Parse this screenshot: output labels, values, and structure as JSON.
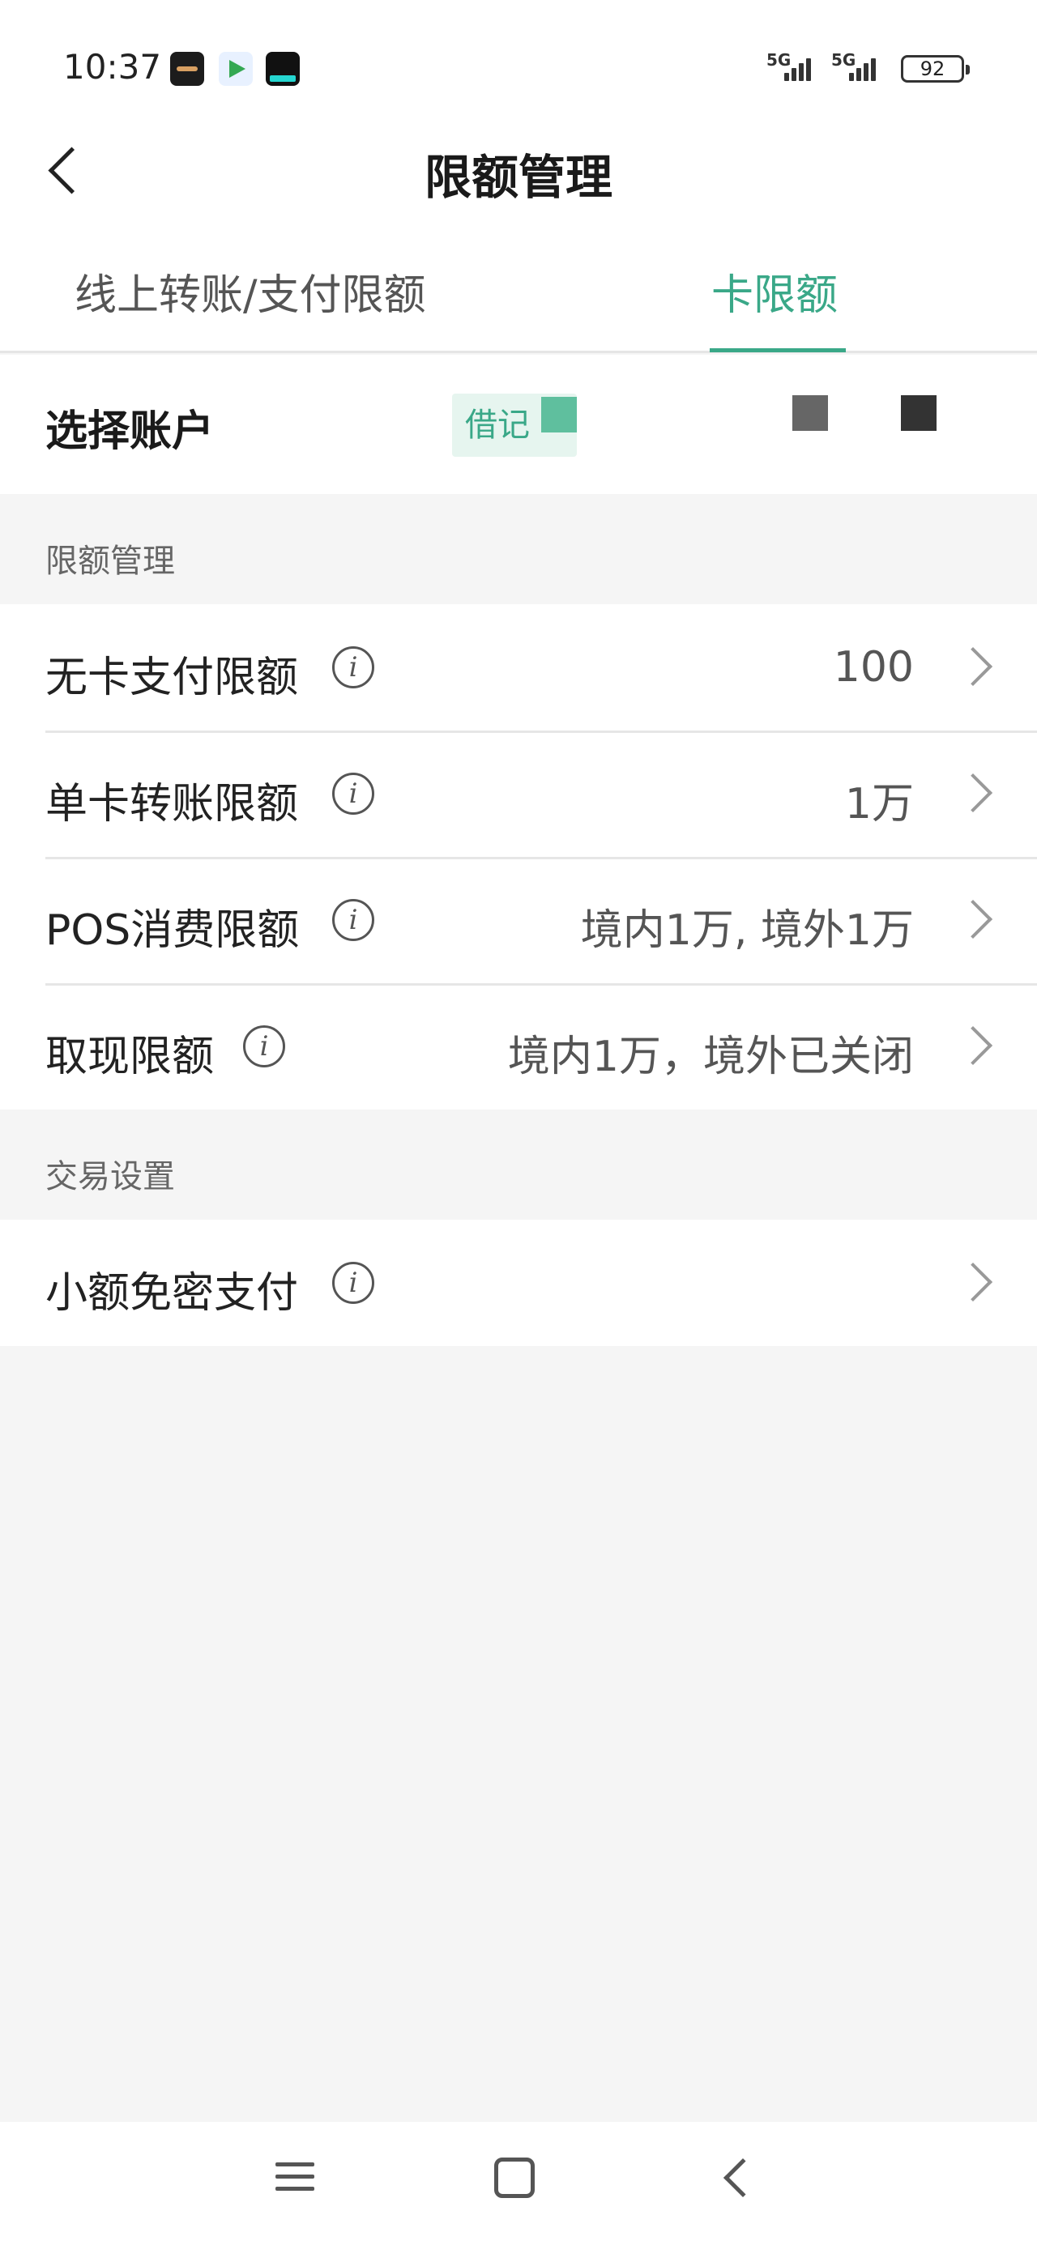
{
  "status_bar": {
    "time": "10:37",
    "battery": "92",
    "signal_1": "5G",
    "signal_2": "5G",
    "apps": [
      "audio-app-icon",
      "play-store-icon",
      "news-app-icon"
    ]
  },
  "header": {
    "title": "限额管理"
  },
  "tabs": [
    {
      "label": "线上转账/支付限额",
      "active": false
    },
    {
      "label": "卡限额",
      "active": true
    }
  ],
  "account": {
    "label": "选择账户",
    "chip": "借记"
  },
  "limit_section": {
    "title": "限额管理",
    "items": [
      {
        "label": "无卡支付限额",
        "value": "100"
      },
      {
        "label": "单卡转账限额",
        "value": "1万"
      },
      {
        "label": "POS消费限额",
        "value": "境内1万, 境外1万"
      },
      {
        "label": "取现限额",
        "value": "境内1万，境外已关闭"
      }
    ]
  },
  "transaction_section": {
    "title": "交易设置",
    "items": [
      {
        "label": "小额免密支付",
        "value": ""
      }
    ]
  },
  "info_glyph": "i",
  "colors": {
    "accent": "#3aa888",
    "chip_bg": "#e6f5ef",
    "page_bg": "#f5f5f5"
  },
  "system_nav": [
    "menu-icon",
    "home-icon",
    "back-icon"
  ]
}
